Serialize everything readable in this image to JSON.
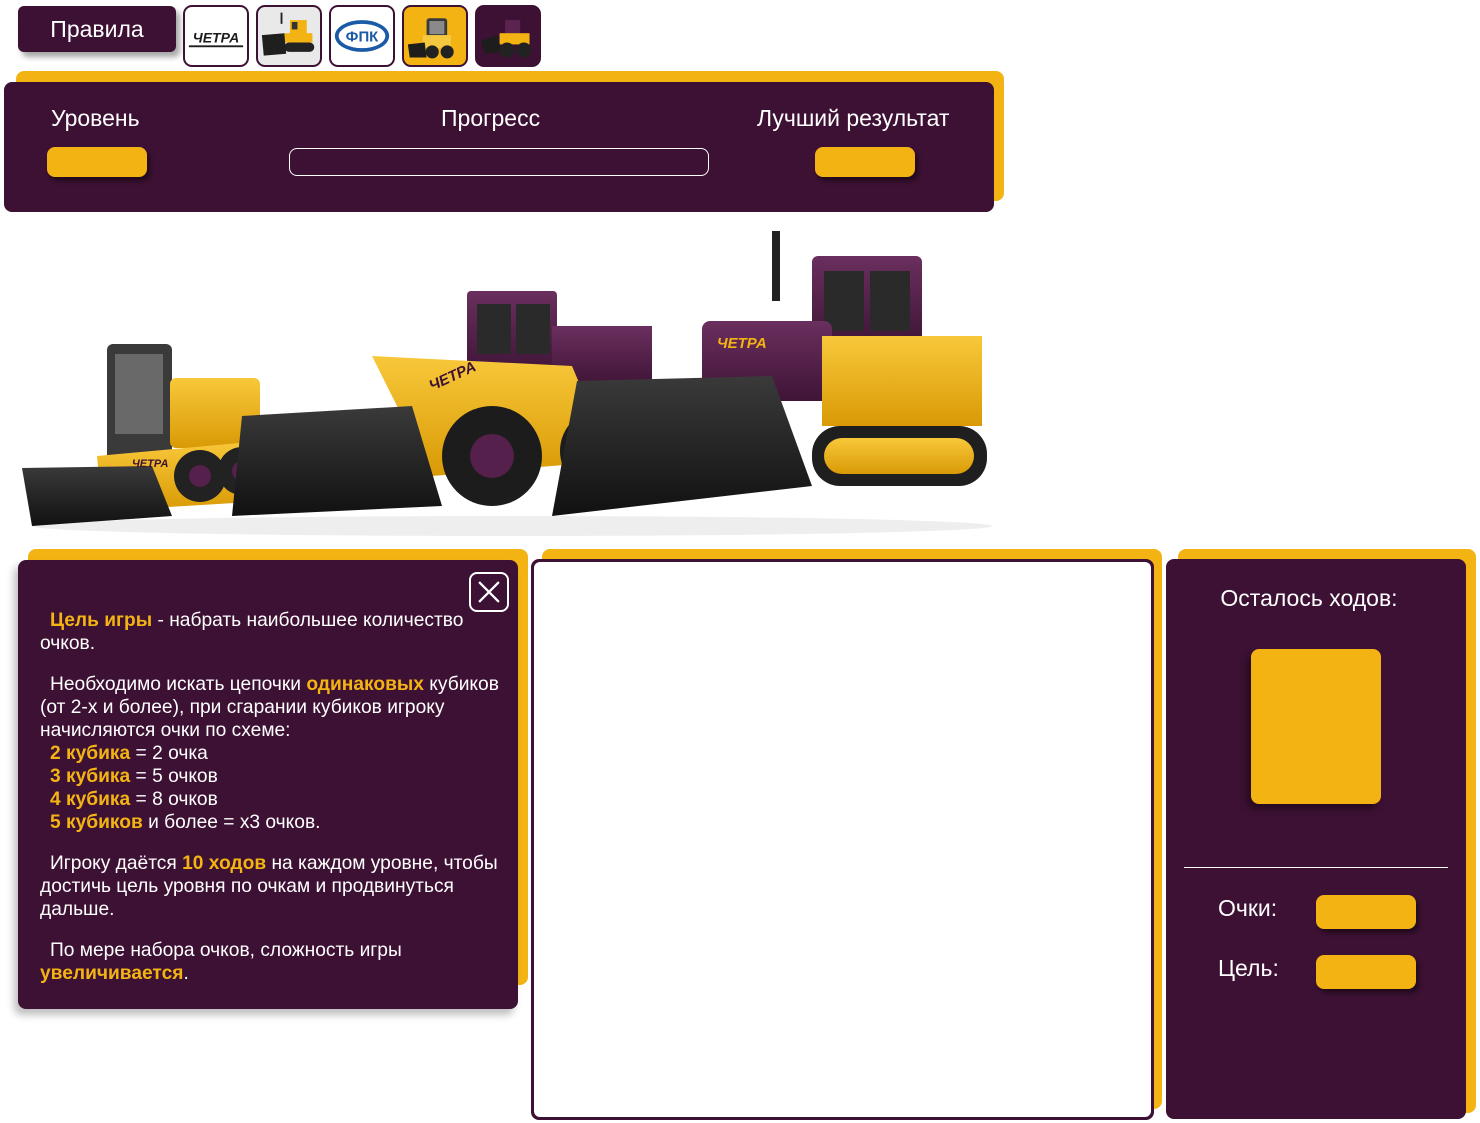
{
  "topbar": {
    "rules_label": "Правила",
    "thumbnails": [
      {
        "name": "chetra-logo",
        "text": "ЧЕТРА"
      },
      {
        "name": "bulldozer-photo"
      },
      {
        "name": "fpk-logo",
        "text": "ФПК"
      },
      {
        "name": "skid-steer-photo"
      },
      {
        "name": "wheel-loader-photo"
      }
    ]
  },
  "stats": {
    "level_label": "Уровень",
    "level_value": "",
    "progress_label": "Прогресс",
    "progress_fraction": 0,
    "best_label": "Лучший результат",
    "best_value": ""
  },
  "banner": {
    "brand_text": "ЧЕТРА"
  },
  "rules": {
    "p1": {
      "hl": "Цель игры",
      "text": " - набрать наибольшее количество очков."
    },
    "p2": {
      "pre": "Необходимо искать цепочки ",
      "hl": "одинаковых",
      "post": " кубиков (от 2-х и более), при сгарании кубиков игроку начисляются очки по схеме:"
    },
    "scheme": [
      {
        "hl": "2 кубика",
        "text": " = 2 очка"
      },
      {
        "hl": "3 кубика",
        "text": " = 5 очков"
      },
      {
        "hl": "4 кубика",
        "text": " = 8 очков"
      },
      {
        "hl": "5 кубиков",
        "text": " и более = х3 очков."
      }
    ],
    "p3": {
      "pre": "Игроку даётся ",
      "hl": "10 ходов",
      "post": " на каждом уровне, чтобы достичь цель уровня по очкам и продвинуться дальше."
    },
    "p4": {
      "pre": "По мере набора очков, сложность игры ",
      "hl": "увеличивается",
      "post": "."
    }
  },
  "side": {
    "moves_label": "Осталось ходов:",
    "moves_value": "",
    "score_label": "Очки:",
    "score_value": "",
    "goal_label": "Цель:",
    "goal_value": ""
  },
  "colors": {
    "plum": "#3d1133",
    "yellow": "#f3b413"
  }
}
